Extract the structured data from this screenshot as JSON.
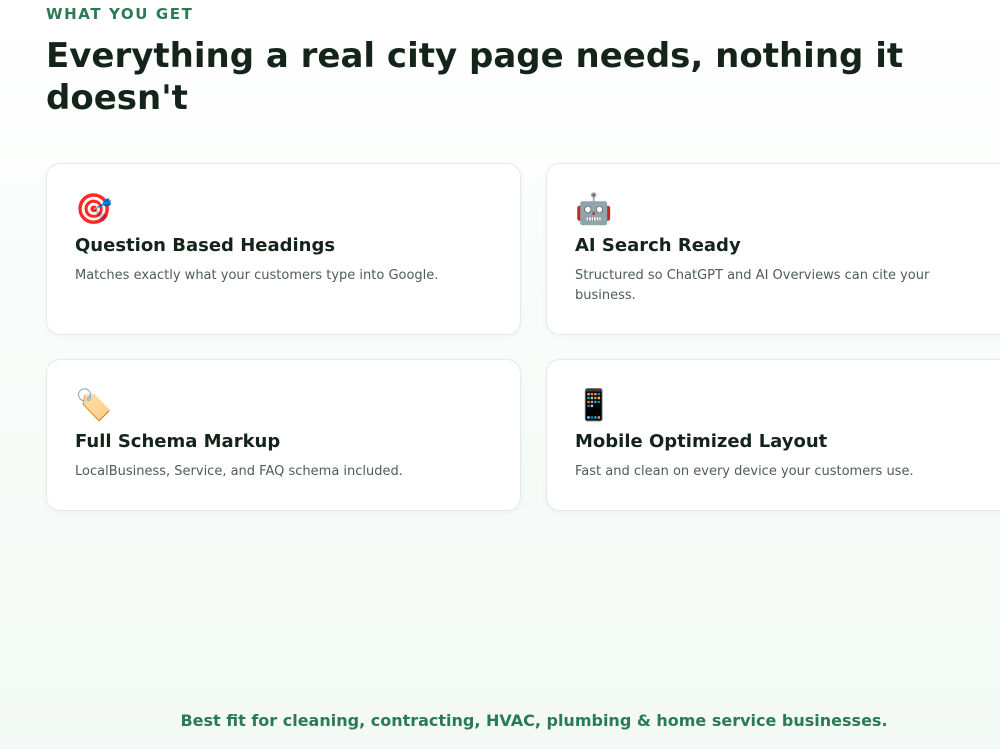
{
  "section": {
    "eyebrow": "WHAT YOU GET",
    "headline": "Everything a real city page needs, nothing it doesn't"
  },
  "features": [
    {
      "icon": "🎯",
      "icon_name": "target-icon",
      "title": "Question Based Headings",
      "description": "Matches exactly what your customers type into Google."
    },
    {
      "icon": "🤖",
      "icon_name": "robot-icon",
      "title": "AI Search Ready",
      "description": "Structured so ChatGPT and AI Overviews can cite your business."
    },
    {
      "icon": "🏷️",
      "icon_name": "tag-icon",
      "title": "Full Schema Markup",
      "description": "LocalBusiness, Service, and FAQ schema included."
    },
    {
      "icon": "📱",
      "icon_name": "mobile-phone-icon",
      "title": "Mobile Optimized Layout",
      "description": "Fast and clean on every device your customers use."
    }
  ],
  "footer": {
    "note": "Best fit for cleaning, contracting, HVAC, plumbing & home service businesses."
  },
  "colors": {
    "accent_green": "#2a7a55",
    "heading_dark": "#14241b",
    "body_text": "#4e5d55",
    "card_border": "#e3ebe6"
  }
}
